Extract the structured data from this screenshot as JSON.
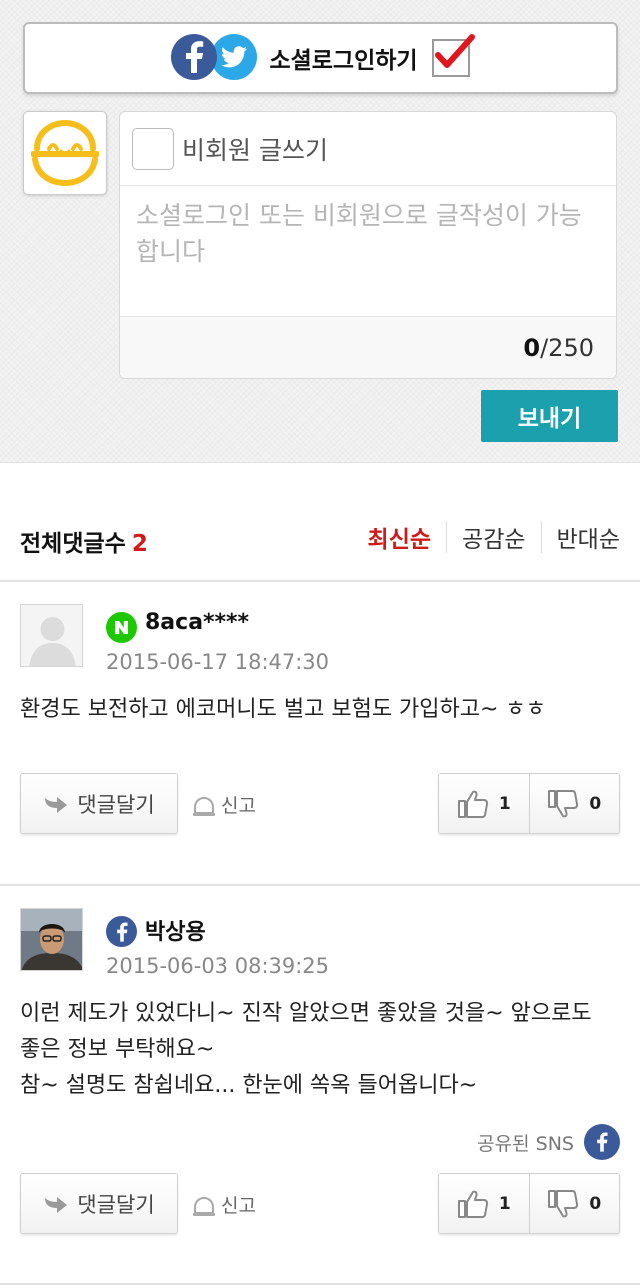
{
  "write": {
    "social_login_label": "소셜로그인하기",
    "guest_label": "비회원 글쓰기",
    "textarea_placeholder": "소셜로그인 또는 비회원으로 글작성이 가능합니다",
    "counter_current": "0",
    "counter_max": "/250",
    "send_label": "보내기"
  },
  "list": {
    "total_label": "전체댓글수",
    "total_count": "2",
    "sort_tabs": [
      "최신순",
      "공감순",
      "반대순"
    ],
    "active_sort": "최신순"
  },
  "comments": [
    {
      "sns": "naver",
      "author": "8aca****",
      "date": "2015-06-17 18:47:30",
      "body_lines": [
        "환경도 보전하고 에코머니도 벌고 보험도 가입하고~ ㅎㅎ"
      ],
      "reply_label": "댓글달기",
      "report_label": "신고",
      "likes": "1",
      "dislikes": "0"
    },
    {
      "sns": "facebook",
      "author": "박상용",
      "date": "2015-06-03 08:39:25",
      "body_lines": [
        "이런 제도가 있었다니~ 진작 알았으면 좋았을 것을~ 앞으로도 좋은 정보 부탁해요~",
        "참~ 설명도 참쉽네요... 한눈에 쏙옥 들어옵니다~"
      ],
      "shared_sns_label": "공유된 SNS",
      "reply_label": "댓글달기",
      "report_label": "신고",
      "likes": "1",
      "dislikes": "0"
    }
  ],
  "colors": {
    "accent_teal": "#1ba0ae",
    "highlight_red": "#d21919",
    "facebook_blue": "#3b5a9a",
    "twitter_blue": "#2ca8e8",
    "naver_green": "#1ec800"
  }
}
